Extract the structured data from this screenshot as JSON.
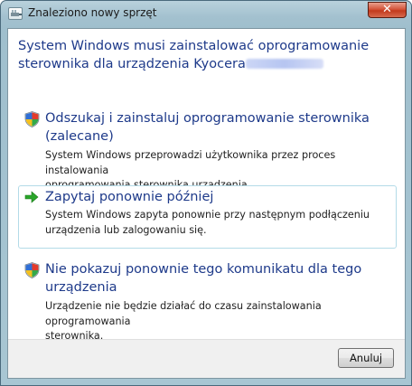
{
  "window": {
    "title": "Znaleziono nowy sprzęt",
    "close_symbol": "✕"
  },
  "heading": {
    "line1": "System Windows musi zainstalować oprogramowanie",
    "line2": "sterownika dla urządzenia Kyocera"
  },
  "options": [
    {
      "icon": "shield-icon",
      "title_line1": "Odszukaj i zainstaluj oprogramowanie sterownika",
      "title_line2": "(zalecane)",
      "desc_line1": "System Windows przeprowadzi użytkownika przez proces instalowania",
      "desc_line2": "oprogramowania sterownika urządzenia."
    },
    {
      "icon": "green-arrow-icon",
      "title_line1": "Zapytaj ponownie później",
      "desc_line1": "System Windows zapyta ponownie przy następnym podłączeniu",
      "desc_line2": "urządzenia lub zalogowaniu się."
    },
    {
      "icon": "shield-icon",
      "title_line1": "Nie pokazuj ponownie tego komunikatu dla tego",
      "title_line2": "urządzenia",
      "desc_line1": "Urządzenie nie będzie działać do czasu zainstalowania oprogramowania",
      "desc_line2": "sterownika."
    }
  ],
  "footer": {
    "cancel_label": "Anuluj"
  },
  "colors": {
    "heading_text": "#1e3a8a",
    "hover_border": "#b3dbe8",
    "arrow_green": "#2aa52a"
  }
}
